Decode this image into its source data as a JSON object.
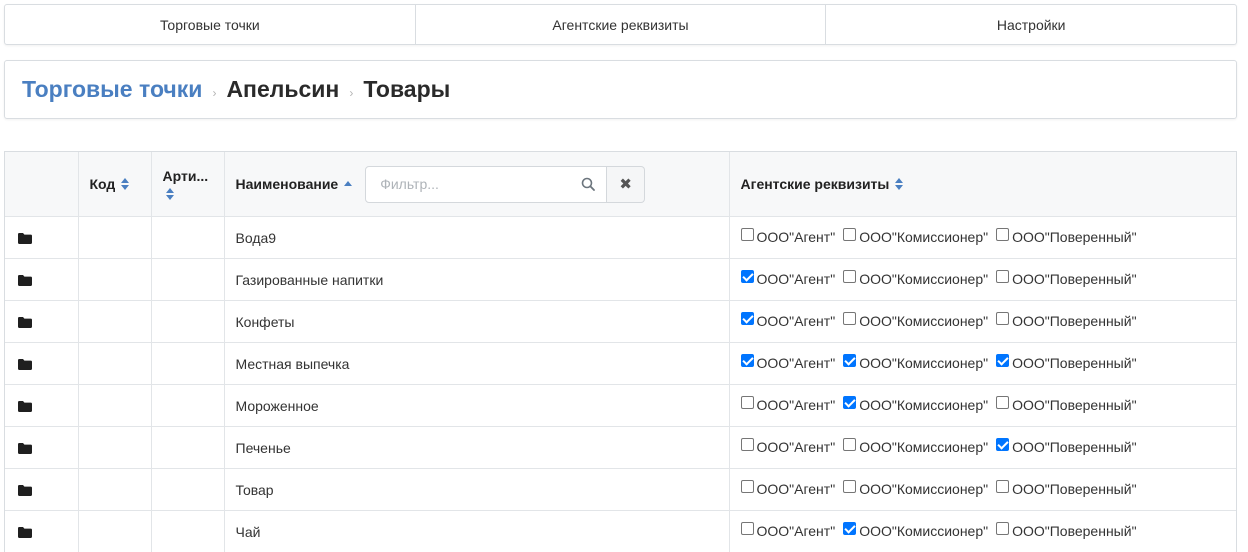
{
  "nav": {
    "tabs": [
      "Торговые точки",
      "Агентские реквизиты",
      "Настройки"
    ]
  },
  "breadcrumb": {
    "root": "Торговые точки",
    "store": "Апельсин",
    "current": "Товары",
    "separator": "›"
  },
  "table": {
    "headers": {
      "code": "Код",
      "article": "Арти...",
      "name": "Наименование",
      "agents": "Агентские реквизиты"
    },
    "filter": {
      "placeholder": "Фильтр...",
      "value": "",
      "clear_label": "✖"
    },
    "agent_names": [
      "ООО\"Агент\"",
      "ООО\"Комиссионер\"",
      "ООО\"Поверенный\""
    ],
    "rows": [
      {
        "name": "Вода9",
        "code": "",
        "article": "",
        "agents": [
          false,
          false,
          false
        ]
      },
      {
        "name": "Газированные напитки",
        "code": "",
        "article": "",
        "agents": [
          true,
          false,
          false
        ]
      },
      {
        "name": "Конфеты",
        "code": "",
        "article": "",
        "agents": [
          true,
          false,
          false
        ]
      },
      {
        "name": "Местная выпечка",
        "code": "",
        "article": "",
        "agents": [
          true,
          true,
          true
        ]
      },
      {
        "name": "Мороженное",
        "code": "",
        "article": "",
        "agents": [
          false,
          true,
          false
        ]
      },
      {
        "name": "Печенье",
        "code": "",
        "article": "",
        "agents": [
          false,
          false,
          true
        ]
      },
      {
        "name": "Товар",
        "code": "",
        "article": "",
        "agents": [
          false,
          false,
          false
        ]
      },
      {
        "name": "Чай",
        "code": "",
        "article": "",
        "agents": [
          false,
          true,
          false
        ]
      }
    ]
  },
  "colors": {
    "accent": "#4a7fc1",
    "checkbox": "#0075ff"
  },
  "icons": {
    "row": "folder-icon",
    "filter": "search-icon",
    "clear": "close-icon"
  }
}
